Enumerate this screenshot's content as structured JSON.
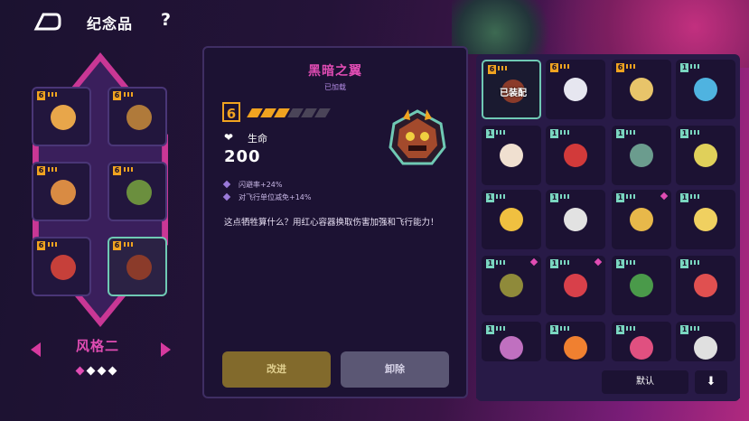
{
  "header": {
    "title": "纪念品",
    "help": "?"
  },
  "loadout": {
    "slots": [
      {
        "tier": "6",
        "icon": "popcorn-icon",
        "color": "#e8a64a"
      },
      {
        "tier": "6",
        "icon": "crate-icon",
        "color": "#b07a3a"
      },
      {
        "tier": "6",
        "icon": "gingerbread-icon",
        "color": "#d98b43"
      },
      {
        "tier": "6",
        "icon": "scroll-icon",
        "color": "#6b8f3e"
      },
      {
        "tier": "6",
        "icon": "bag-icon",
        "color": "#c6403a"
      },
      {
        "tier": "6",
        "icon": "dark-wings-icon",
        "color": "#8b3b2a"
      }
    ],
    "style_label": "风格二",
    "pages": 4,
    "current_page": 0
  },
  "detail": {
    "name": "黑暗之翼",
    "status": "已加载",
    "tier": "6",
    "level_filled": 3,
    "level_total": 6,
    "stat_label": "生命",
    "stat_value": "200",
    "bonuses": [
      "闪避率+24%",
      "对飞行单位减免+14%"
    ],
    "description": "这点牺牲算什么？用红心容器换取伤害加强和飞行能力！",
    "upgrade_label": "改进",
    "remove_label": "卸除"
  },
  "inventory": {
    "equipped_label": "已装配",
    "items": [
      {
        "tier": "6",
        "icon": "dark-wings-icon",
        "color": "#8b3b2a",
        "equipped": true,
        "new": false
      },
      {
        "tier": "6",
        "icon": "unicorn-icon",
        "color": "#e6e6f0",
        "equipped": false,
        "new": false
      },
      {
        "tier": "6",
        "icon": "scroll-icon",
        "color": "#e8c46a",
        "equipped": false,
        "new": false
      },
      {
        "tier": "1",
        "icon": "crystal-icon",
        "color": "#4fb3e0",
        "equipped": false,
        "new": false
      },
      {
        "tier": "1",
        "icon": "lucky-cat-icon",
        "color": "#f0e0d0",
        "equipped": false,
        "new": false
      },
      {
        "tier": "1",
        "icon": "mask-icon",
        "color": "#d23a3a",
        "equipped": false,
        "new": false
      },
      {
        "tier": "1",
        "icon": "goggles-icon",
        "color": "#6b9c8e",
        "equipped": false,
        "new": false
      },
      {
        "tier": "1",
        "icon": "ticket-icon",
        "color": "#e0d05a",
        "equipped": false,
        "new": false
      },
      {
        "tier": "1",
        "icon": "flame-doll-icon",
        "color": "#f0c040",
        "equipped": false,
        "new": false
      },
      {
        "tier": "1",
        "icon": "calendar-icon",
        "color": "#e2e2e2",
        "equipped": false,
        "new": false
      },
      {
        "tier": "1",
        "icon": "leaf-icon",
        "color": "#e8b84a",
        "equipped": false,
        "new": true
      },
      {
        "tier": "1",
        "icon": "tooth-icon",
        "color": "#f0d060",
        "equipped": false,
        "new": false
      },
      {
        "tier": "1",
        "icon": "helmet-icon",
        "color": "#8f8a3a",
        "equipped": false,
        "new": true
      },
      {
        "tier": "1",
        "icon": "feather-icon",
        "color": "#d8404a",
        "equipped": false,
        "new": true
      },
      {
        "tier": "1",
        "icon": "chip-icon",
        "color": "#4a9a4a",
        "equipped": false,
        "new": false
      },
      {
        "tier": "1",
        "icon": "scroll-red-icon",
        "color": "#e05050",
        "equipped": false,
        "new": false
      },
      {
        "tier": "1",
        "icon": "snack-bag-icon",
        "color": "#c070c0",
        "equipped": false,
        "new": false
      },
      {
        "tier": "1",
        "icon": "orange-icon",
        "color": "#f08030",
        "equipped": false,
        "new": false
      },
      {
        "tier": "1",
        "icon": "wand-icon",
        "color": "#e05080",
        "equipped": false,
        "new": false
      },
      {
        "tier": "1",
        "icon": "skull-badge-icon",
        "color": "#e0e0e0",
        "equipped": false,
        "new": false
      }
    ],
    "default_label": "默认",
    "down_label": "⬇"
  },
  "colors": {
    "accent": "#e04cb3",
    "gold": "#f0a320",
    "teal": "#6fc9b4",
    "tier1": "#7ad6c0"
  }
}
